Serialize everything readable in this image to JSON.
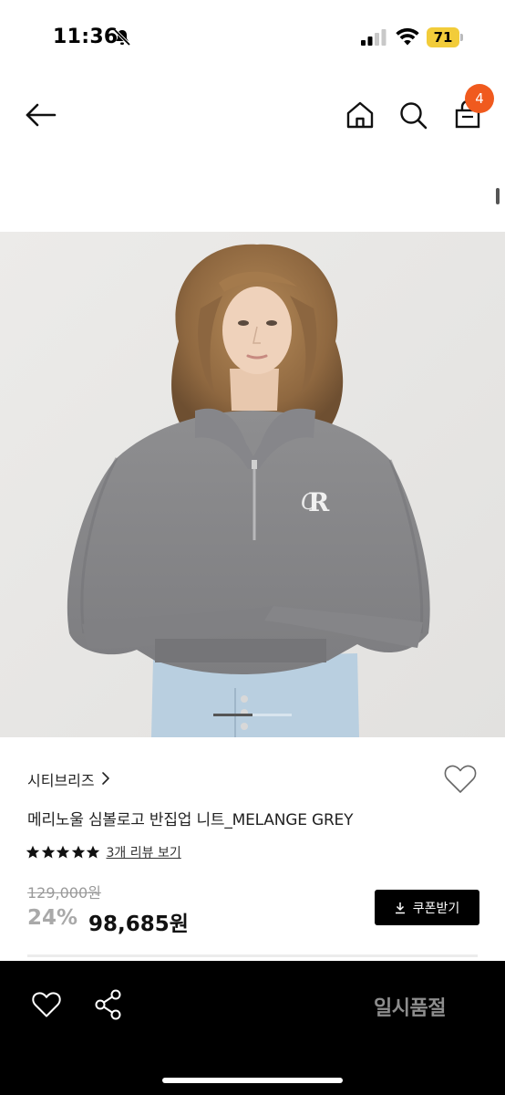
{
  "status_bar": {
    "time": "11:36",
    "battery_level": "71",
    "icons": [
      "bell-slash-icon",
      "signal-icon",
      "wifi-icon",
      "battery-icon"
    ],
    "battery_color": "#f2cc3a"
  },
  "nav": {
    "icons": [
      "back-arrow-icon",
      "home-icon",
      "search-icon",
      "shopping-bag-icon"
    ],
    "cart_count": "4",
    "badge_color": "#f05a1e"
  },
  "product": {
    "image": "model-in-grey-half-zip-knit",
    "brand": "시티브리즈",
    "name": "메리노울 심볼로고 반집업 니트_MELANGE GREY",
    "rating_stars": 5,
    "review_link": "3개 리뷰 보기",
    "original_price": "129,000원",
    "discount_rate": "24%",
    "sale_price": "98,685원",
    "coupon_label": "쿠폰받기",
    "carousel_position": 0.5
  },
  "bottom_bar": {
    "status_label": "일시품절",
    "icons": [
      "heart-icon",
      "share-icon"
    ]
  }
}
